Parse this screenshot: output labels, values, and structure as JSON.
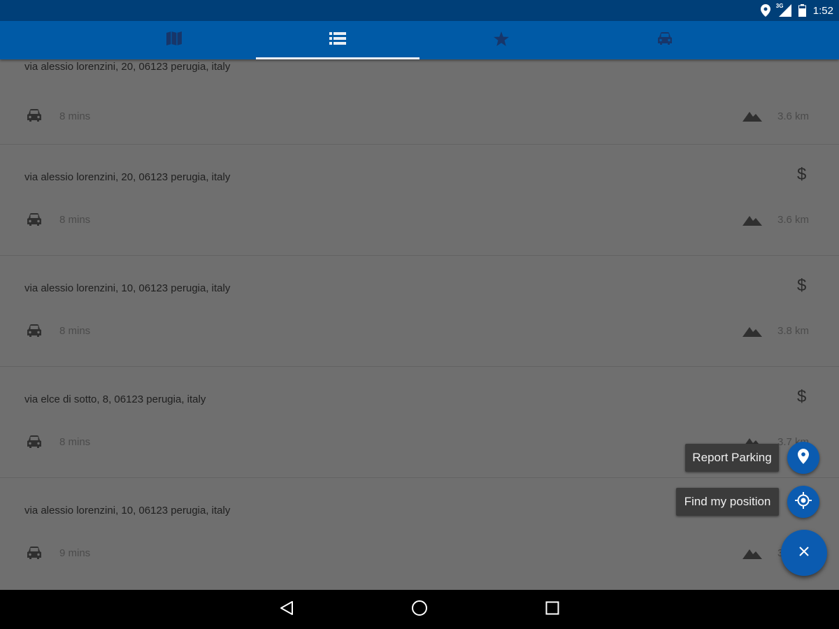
{
  "status_bar": {
    "time": "1:52",
    "network_label": "3G",
    "icons": [
      "location-pin-icon",
      "signal-icon",
      "battery-icon"
    ]
  },
  "tabs": [
    {
      "name": "map",
      "icon": "map-icon",
      "selected": false
    },
    {
      "name": "list",
      "icon": "list-icon",
      "selected": true
    },
    {
      "name": "favorites",
      "icon": "star-icon",
      "selected": false
    },
    {
      "name": "car",
      "icon": "car-icon",
      "selected": false
    }
  ],
  "parking_list": [
    {
      "address": "via alessio lorenzini, 20, 06123 perugia, italy",
      "paid": false,
      "duration": "8 mins",
      "distance": "3.6 km"
    },
    {
      "address": "via alessio lorenzini, 20, 06123 perugia, italy",
      "paid": true,
      "price_symbol": "$",
      "duration": "8 mins",
      "distance": "3.6 km"
    },
    {
      "address": "via alessio lorenzini, 10, 06123 perugia, italy",
      "paid": true,
      "price_symbol": "$",
      "duration": "8 mins",
      "distance": "3.8 km"
    },
    {
      "address": "via elce di sotto, 8, 06123 perugia, italy",
      "paid": true,
      "price_symbol": "$",
      "duration": "8 mins",
      "distance": "3.7 km"
    },
    {
      "address": "via alessio lorenzini, 10, 06123 perugia, italy",
      "paid": false,
      "duration": "9 mins",
      "distance": "3"
    }
  ],
  "fab_menu": {
    "report_parking_label": "Report Parking",
    "find_position_label": "Find my position",
    "close_icon": "close-icon"
  },
  "colors": {
    "status_bar": "#003f78",
    "tab_bar": "#005aa6",
    "fab": "#0b5bb0",
    "scrim_background": "#6f6f6f"
  }
}
